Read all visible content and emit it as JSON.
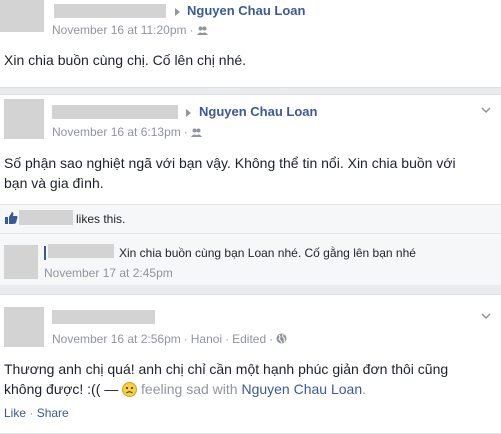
{
  "post1": {
    "target_name": "Nguyen Chau Loan",
    "time": "November 16 at 11:20pm",
    "text": "Xin chia buồn cùng chị. Cố lên chị nhé."
  },
  "post2": {
    "target_name": "Nguyen Chau Loan",
    "time": "November 16 at 6:13pm",
    "text_line1": "Số phận sao nghiệt ngã với bạn vậy. Không thể tin nổi. Xin chia buồn với",
    "text_line2": "bạn và gia đình.",
    "likes_text": "likes this.",
    "comment": {
      "text": "Xin chia buồn cùng bạn Loan nhé. Cố gằng lên bạn nhé",
      "time": "November 17 at 2:45pm"
    }
  },
  "post3": {
    "time": "November 16 at 2:56pm",
    "location": "Hanoi",
    "edited": "Edited",
    "text_line1": "Thương anh chị quá! anh chị chỉ cần một hạnh phúc giản đơn thôi cũng",
    "text_line2_prefix": "không được! :(( —",
    "feeling": "feeling sad with",
    "tagged": "Nguyen Chau Loan",
    "tagged_suffix": ".",
    "like_label": "Like",
    "share_label": "Share"
  },
  "icons": [
    "friends-icon",
    "globe-icon",
    "chevron-down-icon",
    "sad-emoji-icon",
    "thumbs-up-icon"
  ]
}
